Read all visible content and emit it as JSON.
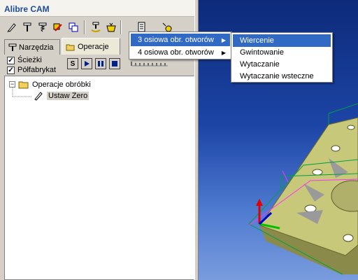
{
  "panel": {
    "title": "Alibre CAM"
  },
  "toolbar": {
    "icons": [
      "pencil-icon",
      "drill-icon",
      "tap-icon",
      "cutter-icon",
      "copy-icon",
      "drill-operation-icon",
      "pocket-icon",
      "report-icon",
      "camera-icon"
    ]
  },
  "tabs": {
    "tools_label": "Narzędzia",
    "operations_label": "Operacje"
  },
  "options": {
    "paths_label": "Ścieżki",
    "paths_checked": true,
    "stock_label": "Półfabrykat",
    "stock_checked": true,
    "sim_step_label": "S"
  },
  "tree": {
    "root_label": "Operacje obróbki",
    "child_label": "Ustaw Zero"
  },
  "menu": {
    "items": [
      {
        "label": "3 osiowa obr. otworów",
        "highlighted": true
      },
      {
        "label": "4 osiowa obr. otworów",
        "highlighted": false
      }
    ],
    "submenu": [
      {
        "label": "Wiercenie",
        "highlighted": true
      },
      {
        "label": "Gwintowanie",
        "highlighted": false
      },
      {
        "label": "Wytaczanie",
        "highlighted": false
      },
      {
        "label": "Wytaczanie wsteczne",
        "highlighted": false
      }
    ]
  },
  "colors": {
    "title_text": "#1e4b9e",
    "menu_highlight": "#316ac5",
    "part_fill": "#c8c87a"
  }
}
